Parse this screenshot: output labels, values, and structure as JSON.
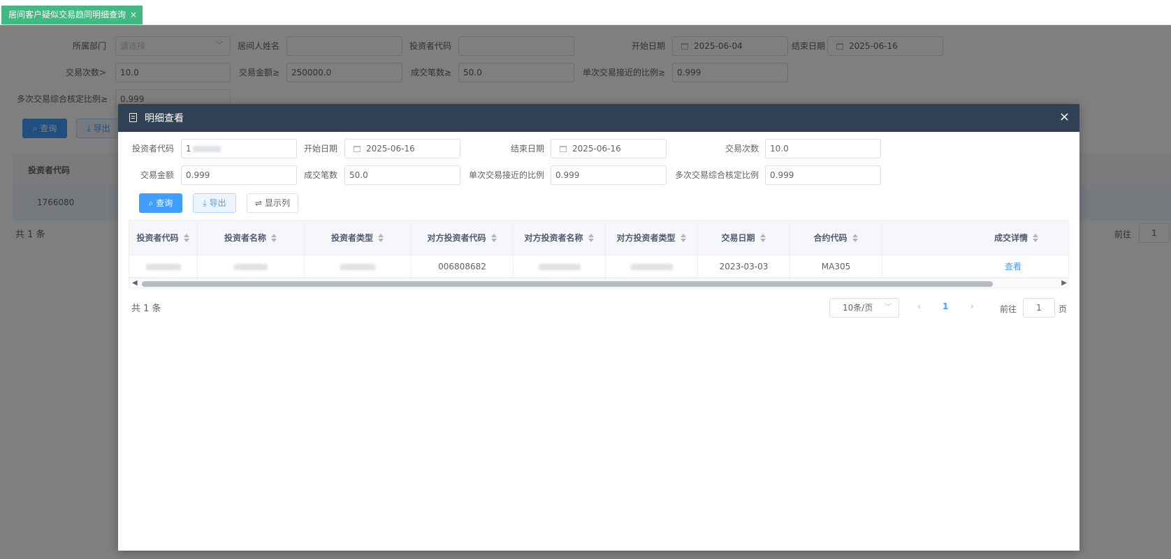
{
  "tab": {
    "label": "居间客户疑似交易趋同明细查询",
    "close": "×"
  },
  "filters": {
    "dept_label": "所属部门",
    "dept_placeholder": "请选择",
    "broker_name_label": "居间人姓名",
    "broker_name_value": "",
    "investor_code_label": "投资者代码",
    "investor_code_value": "",
    "start_date_label": "开始日期",
    "start_date_value": "2025-06-04",
    "end_date_label": "结束日期",
    "end_date_value": "2025-06-16",
    "trade_count_label": "交易次数>",
    "trade_count_value": "10.0",
    "trade_amount_label": "交易金额≥",
    "trade_amount_value": "250000.0",
    "deal_count_label": "成交笔数≥",
    "deal_count_value": "50.0",
    "single_ratio_label": "单次交易接近的比例≥",
    "single_ratio_value": "0.999",
    "multi_ratio_label": "多次交易综合核定比例≥",
    "multi_ratio_value": "0.999",
    "query_btn": "查询",
    "export_btn": "导出"
  },
  "bg_table": {
    "header": "投资者代码",
    "row_value": "1766080",
    "total": "共 1 条",
    "goto_label": "前往",
    "goto_value": "1"
  },
  "dialog": {
    "title": "明细查看",
    "close": "×",
    "form": {
      "investor_code_label": "投资者代码",
      "investor_code_value": "1",
      "start_date_label": "开始日期",
      "start_date_value": "2025-06-16",
      "end_date_label": "结束日期",
      "end_date_value": "2025-06-16",
      "trade_count_label": "交易次数",
      "trade_count_value": "10.0",
      "trade_amount_label": "交易金额",
      "trade_amount_value": "0.999",
      "deal_count_label": "成交笔数",
      "deal_count_value": "50.0",
      "single_ratio_label": "单次交易接近的比例",
      "single_ratio_value": "0.999",
      "multi_ratio_label": "多次交易综合核定比例",
      "multi_ratio_value": "0.999",
      "query_btn": "查询",
      "export_btn": "导出",
      "columns_btn": "显示列"
    },
    "table": {
      "columns": [
        "投资者代码",
        "投资者名称",
        "投资者类型",
        "对方投资者代码",
        "对方投资者名称",
        "对方投资者类型",
        "交易日期",
        "合约代码",
        "成交详情"
      ],
      "row": {
        "counterparty_code": "006808682",
        "trade_date": "2023-03-03",
        "contract_code": "MA305",
        "detail_link": "查看"
      }
    },
    "pagination": {
      "total": "共 1 条",
      "page_size": "10条/页",
      "current_page": "1",
      "goto_label": "前往",
      "goto_value": "1",
      "page_suffix": "页"
    }
  }
}
